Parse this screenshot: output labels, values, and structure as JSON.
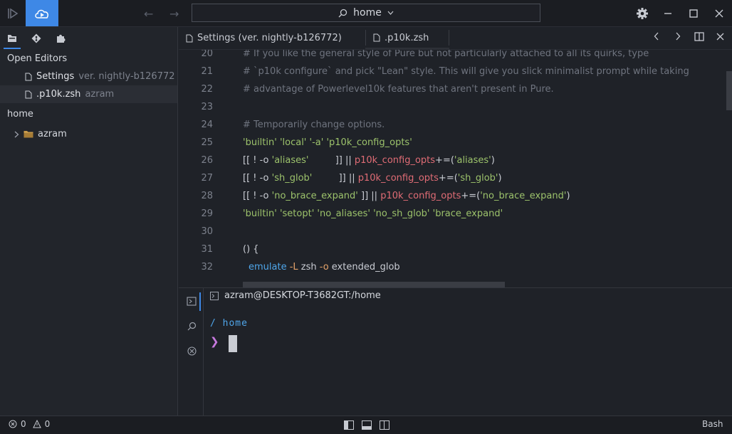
{
  "titlebar": {
    "search_label": "home",
    "icons": [
      "run-icon",
      "cloud-run-icon",
      "back-arrow-icon",
      "forward-arrow-icon",
      "search-icon",
      "chevron-down-icon",
      "gear-icon",
      "minimize-icon",
      "maximize-icon",
      "close-icon"
    ]
  },
  "sidebar": {
    "open_editors_header": "Open Editors",
    "open_editors": [
      {
        "name": "Settings",
        "sub": "ver. nightly-b126772"
      },
      {
        "name": ".p10k.zsh",
        "sub": "azram"
      }
    ],
    "workspace_header": "home",
    "folders": [
      {
        "name": "azram"
      }
    ]
  },
  "tabs": [
    {
      "label": "Settings (ver. nightly-b126772)"
    },
    {
      "label": ".p10k.zsh"
    }
  ],
  "editor": {
    "lines": [
      {
        "n": "20",
        "text": "# If you like the general style of Pure but not particularly attached to all its quirks, type"
      },
      {
        "n": "21",
        "text": "# `p10k configure` and pick \"Lean\" style. This will give you slick minimalist prompt while taking"
      },
      {
        "n": "22",
        "text": "# advantage of Powerlevel10k features that aren't present in Pure."
      },
      {
        "n": "23",
        "text": ""
      },
      {
        "n": "24",
        "text": "# Temporarily change options."
      },
      {
        "n": "25",
        "text": "'builtin' 'local' '-a' 'p10k_config_opts'"
      },
      {
        "n": "26",
        "a": "[[ ! -o ",
        "b": "'aliases'",
        "c": "         ]] || ",
        "d": "p10k_config_opts",
        "e": "+=(",
        "f": "'aliases'",
        "g": ")"
      },
      {
        "n": "27",
        "a": "[[ ! -o ",
        "b": "'sh_glob'",
        "c": "         ]] || ",
        "d": "p10k_config_opts",
        "e": "+=(",
        "f": "'sh_glob'",
        "g": ")"
      },
      {
        "n": "28",
        "a": "[[ ! -o ",
        "b": "'no_brace_expand'",
        "c": " ]] || ",
        "d": "p10k_config_opts",
        "e": "+=(",
        "f": "'no_brace_expand'",
        "g": ")"
      },
      {
        "n": "29",
        "text": "'builtin' 'setopt' 'no_aliases' 'no_sh_glob' 'brace_expand'"
      },
      {
        "n": "30",
        "text": ""
      },
      {
        "n": "31",
        "text": "() {"
      },
      {
        "n": "32",
        "a": "emulate",
        "b": " -L",
        "c": " zsh",
        "d": " -o",
        "e": " extended_glob"
      }
    ]
  },
  "terminal": {
    "title": "azram@DESKTOP-T3682GT:/home",
    "path": "/ home",
    "prompt": "❯"
  },
  "status": {
    "errors": "0",
    "warnings": "0",
    "language": "Bash"
  },
  "colors": {
    "accent": "#3e88e6",
    "string": "#9cc26b",
    "variable": "#e06c75",
    "comment": "#6f747f"
  }
}
